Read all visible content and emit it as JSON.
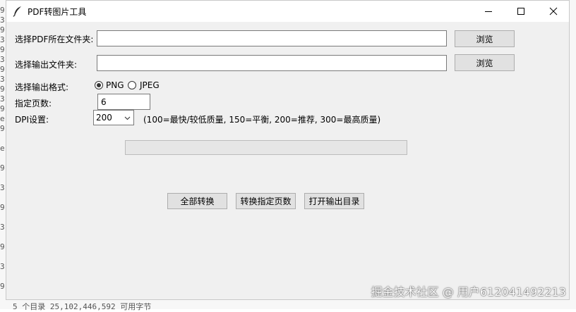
{
  "window": {
    "title": "PDF转图片工具"
  },
  "form": {
    "source_label": "选择PDF所在文件夹:",
    "source_value": "",
    "output_label": "选择输出文件夹:",
    "output_value": "",
    "browse_label": "浏览",
    "format_label": "选择输出格式:",
    "format_options": [
      "PNG",
      "JPEG"
    ],
    "format_selected": "PNG",
    "pages_label": "指定页数:",
    "pages_value": "6",
    "dpi_label": "DPI设置:",
    "dpi_value": "200",
    "dpi_hint": "(100=最快/较低质量, 150=平衡, 200=推荐, 300=最高质量)"
  },
  "progress": {
    "value": 0
  },
  "actions": {
    "convert_all": "全部转换",
    "convert_pages": "转换指定页数",
    "open_output": "打开输出目录"
  },
  "watermark": "掘金技术社区 @ 用户612041492213",
  "background_console": {
    "bottom_text": "5 个目录 25,102,446,592 可用字节"
  },
  "colors": {
    "window_bg": "#f0f0f0",
    "button_bg": "#e1e1e1",
    "titlebar_bg": "#ffffff"
  }
}
